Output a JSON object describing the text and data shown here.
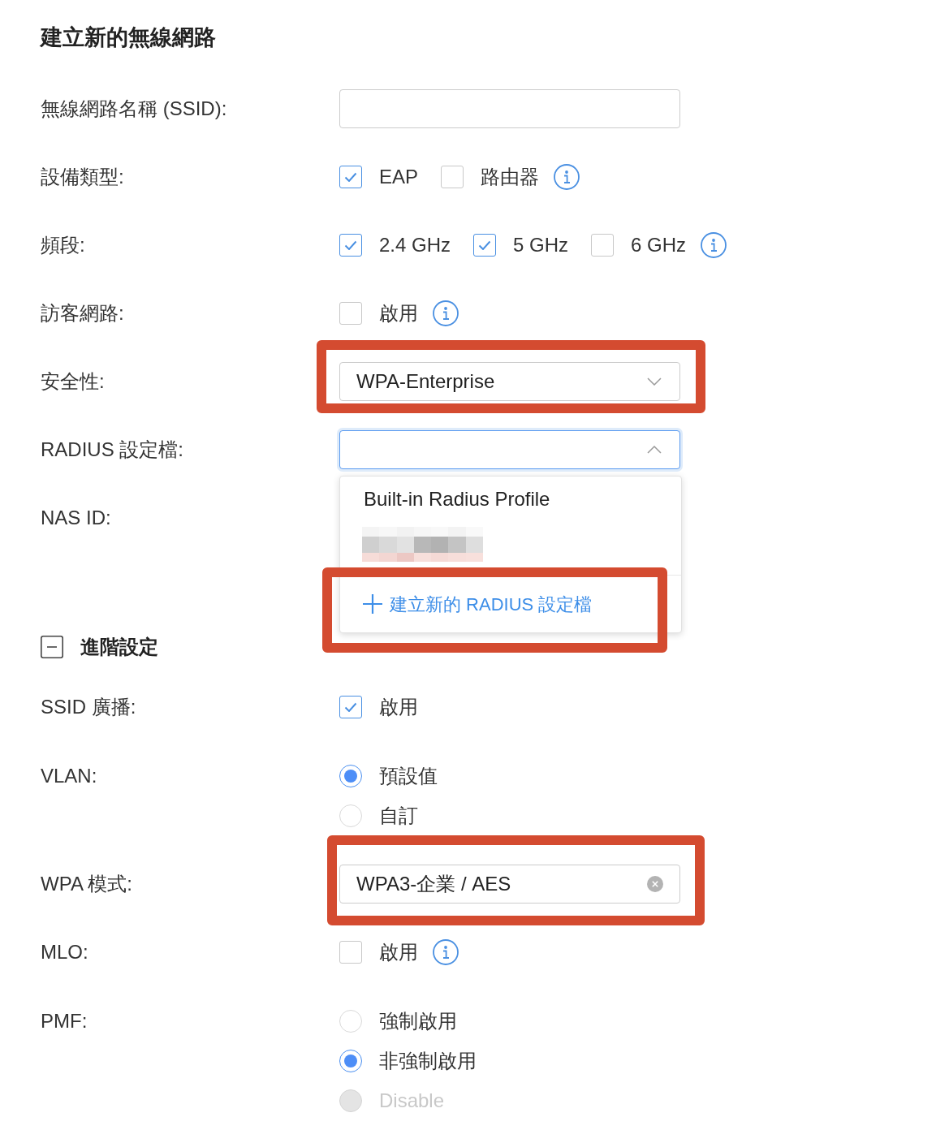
{
  "title": "建立新的無線網路",
  "basic_fields": [
    {
      "kind": "text",
      "label": "無線網路名稱 (SSID):"
    },
    {
      "kind": "checkboxes",
      "label": "設備類型:",
      "options": [
        {
          "label": "EAP",
          "checked": true
        },
        {
          "label": "路由器",
          "checked": false
        }
      ],
      "info": true
    },
    {
      "kind": "checkboxes",
      "label": "頻段:",
      "options": [
        {
          "label": "2.4 GHz",
          "checked": true
        },
        {
          "label": "5 GHz",
          "checked": true
        },
        {
          "label": "6 GHz",
          "checked": false
        }
      ],
      "info": true
    },
    {
      "kind": "checkboxes",
      "label": "訪客網路:",
      "options": [
        {
          "label": "啟用",
          "checked": false
        }
      ],
      "info": true
    },
    {
      "kind": "select",
      "label": "安全性:",
      "value": "WPA-Enterprise",
      "expanded": false,
      "highlighted": true
    },
    {
      "kind": "select",
      "label": "RADIUS 設定檔:",
      "expanded": true,
      "menu": [
        {
          "kind": "option",
          "label": "Built-in Radius Profile"
        },
        {
          "kind": "redacted"
        },
        {
          "kind": "action",
          "label": "建立新的 RADIUS 設定檔",
          "highlighted": true
        }
      ]
    },
    {
      "kind": "covered",
      "label": "NAS ID:"
    }
  ],
  "advanced": {
    "label": "進階設定",
    "expanded": true
  },
  "advanced_fields": [
    {
      "kind": "checkboxes",
      "label": "SSID 廣播:",
      "options": [
        {
          "label": "啟用",
          "checked": true
        }
      ]
    },
    {
      "kind": "radios",
      "label": "VLAN:",
      "options": [
        {
          "label": "預設值",
          "selected": true,
          "disabled": false
        },
        {
          "label": "自訂",
          "selected": false,
          "disabled": false
        }
      ]
    },
    {
      "kind": "select",
      "label": "WPA 模式:",
      "value": "WPA3-企業 / AES",
      "clearable": true,
      "expanded": false,
      "highlighted": true
    },
    {
      "kind": "checkboxes",
      "label": "MLO:",
      "options": [
        {
          "label": "啟用",
          "checked": false
        }
      ],
      "info": true
    },
    {
      "kind": "radios",
      "label": "PMF:",
      "options": [
        {
          "label": "強制啟用",
          "selected": false,
          "disabled": false
        },
        {
          "label": "非強制啟用",
          "selected": true,
          "disabled": false
        },
        {
          "label": "Disable",
          "selected": false,
          "disabled": true
        }
      ]
    }
  ]
}
